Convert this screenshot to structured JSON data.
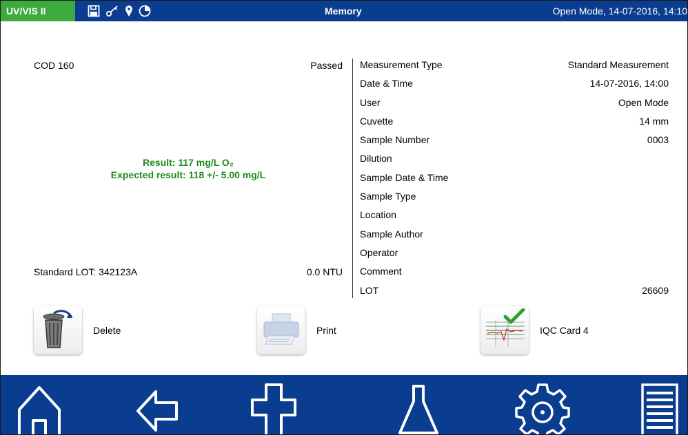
{
  "topbar": {
    "brand": "UV/VIS II",
    "title": "Memory",
    "right_status": "Open Mode, 14-07-2016, 14:10",
    "icons": [
      "save-icon",
      "key-icon",
      "location-pin-icon",
      "timer-icon"
    ]
  },
  "left": {
    "test_name": "COD 160",
    "test_status": "Passed",
    "result_line": "Result: 117 mg/L O₂",
    "expected_line": "Expected result: 118 +/- 5.00 mg/L",
    "standard_lot": "Standard LOT: 342123A",
    "turbidity": "0.0 NTU"
  },
  "details": [
    {
      "label": "Measurement Type",
      "value": "Standard Measurement"
    },
    {
      "label": "Date & Time",
      "value": "14-07-2016, 14:00"
    },
    {
      "label": "User",
      "value": "Open Mode"
    },
    {
      "label": "Cuvette",
      "value": "14 mm"
    },
    {
      "label": "Sample Number",
      "value": "0003"
    },
    {
      "label": "Dilution",
      "value": ""
    },
    {
      "label": "Sample Date & Time",
      "value": ""
    },
    {
      "label": "Sample Type",
      "value": ""
    },
    {
      "label": "Location",
      "value": ""
    },
    {
      "label": "Sample Author",
      "value": ""
    },
    {
      "label": "Operator",
      "value": ""
    },
    {
      "label": "Comment",
      "value": ""
    },
    {
      "label": "LOT",
      "value": "26609"
    }
  ],
  "actions": {
    "delete_label": "Delete",
    "print_label": "Print",
    "iqc_label": "IQC Card 4"
  },
  "bottom_nav": [
    "home-icon",
    "back-arrow-icon",
    "add-icon",
    "flask-icon",
    "settings-gear-icon",
    "menu-list-icon"
  ],
  "colors": {
    "bar_blue": "#0a3d8f",
    "brand_green": "#3caa3c",
    "result_green": "#1a8a1a"
  }
}
